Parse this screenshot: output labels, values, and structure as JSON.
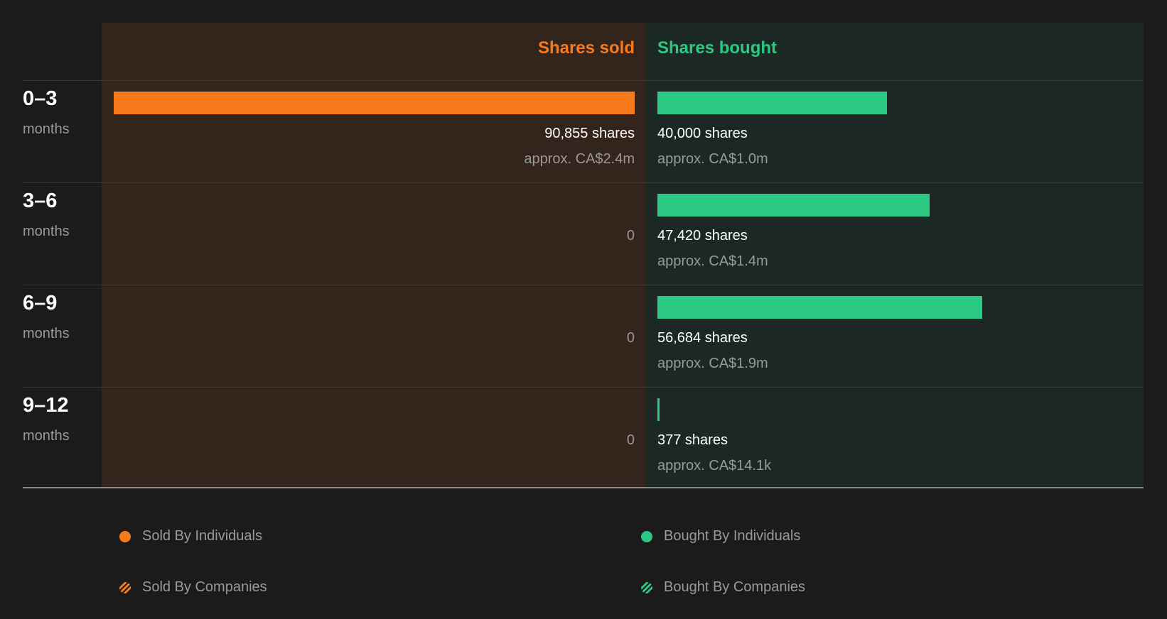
{
  "chart_data": {
    "type": "bar",
    "header_sold": "Shares sold",
    "header_bought": "Shares bought",
    "colors": {
      "sold": "#f97a1a",
      "bought": "#2cc983",
      "sold_bg": "#33241c",
      "bought_bg": "#1c2823"
    },
    "rows": [
      {
        "period": "0–3",
        "unit": "months",
        "sold": 90855,
        "sold_label": "90,855 shares",
        "sold_value": "approx. CA$2.4m",
        "bought": 40000,
        "bought_label": "40,000 shares",
        "bought_value": "approx. CA$1.0m"
      },
      {
        "period": "3–6",
        "unit": "months",
        "sold": 0,
        "sold_label": "0",
        "sold_value": "",
        "bought": 47420,
        "bought_label": "47,420 shares",
        "bought_value": "approx. CA$1.4m"
      },
      {
        "period": "6–9",
        "unit": "months",
        "sold": 0,
        "sold_label": "0",
        "sold_value": "",
        "bought": 56684,
        "bought_label": "56,684 shares",
        "bought_value": "approx. CA$1.9m"
      },
      {
        "period": "9–12",
        "unit": "months",
        "sold": 0,
        "sold_label": "0",
        "sold_value": "",
        "bought": 377,
        "bought_label": "377 shares",
        "bought_value": "approx. CA$14.1k"
      }
    ],
    "legend": [
      {
        "label": "Sold By Individuals",
        "style": "solid",
        "side": "sold"
      },
      {
        "label": "Bought By Individuals",
        "style": "solid",
        "side": "bought"
      },
      {
        "label": "Sold By Companies",
        "style": "striped",
        "side": "sold"
      },
      {
        "label": "Bought By Companies",
        "style": "striped",
        "side": "bought"
      }
    ]
  }
}
